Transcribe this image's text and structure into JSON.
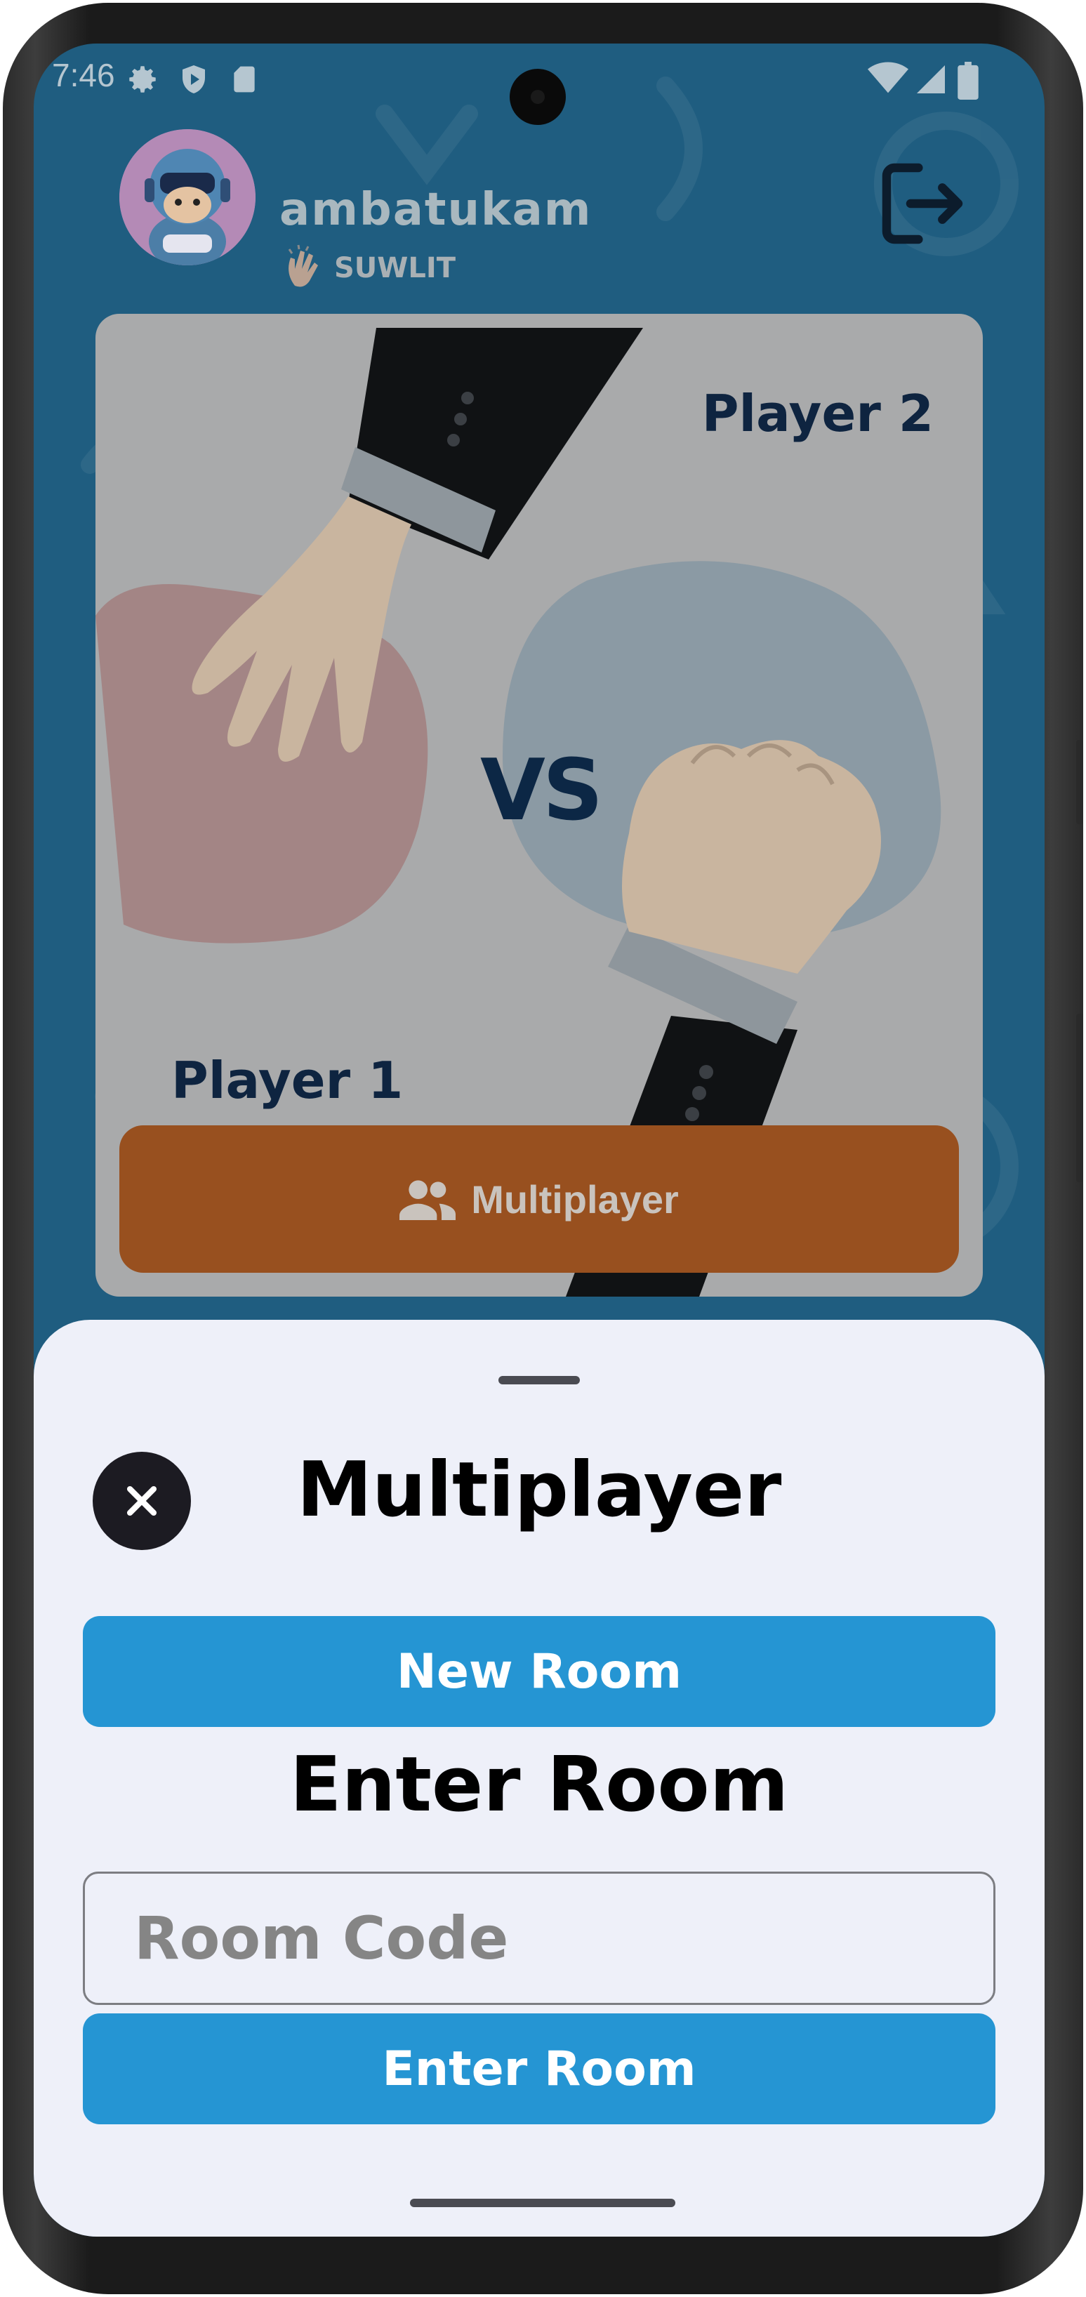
{
  "status_bar": {
    "time": "7:46"
  },
  "profile": {
    "username": "ambatukam",
    "badge": "SUWLIT"
  },
  "hero": {
    "player2_label": "Player 2",
    "player1_label": "Player 1",
    "vs_label": "VS"
  },
  "menu": {
    "multiplayer_label": "Multiplayer"
  },
  "sheet": {
    "title": "Multiplayer",
    "new_room_label": "New Room",
    "enter_room_heading": "Enter Room",
    "room_code_placeholder": "Room Code",
    "enter_room_button": "Enter Room"
  },
  "icons": {
    "settings": "gear-icon",
    "shield": "shield-play-icon",
    "sdcard": "sd-card-icon",
    "wifi": "wifi-icon",
    "signal": "signal-icon",
    "battery": "battery-icon",
    "logout": "logout-icon",
    "multiplayer": "people-icon",
    "close": "close-icon"
  },
  "colors": {
    "background": "#1f5d80",
    "card": "#a9aaab",
    "multiplayer_button": "#98501f",
    "sheet": "#eef0f9",
    "primary_button": "#2595d3",
    "close_button": "#1c1b22",
    "dark_text": "#0e2440"
  }
}
